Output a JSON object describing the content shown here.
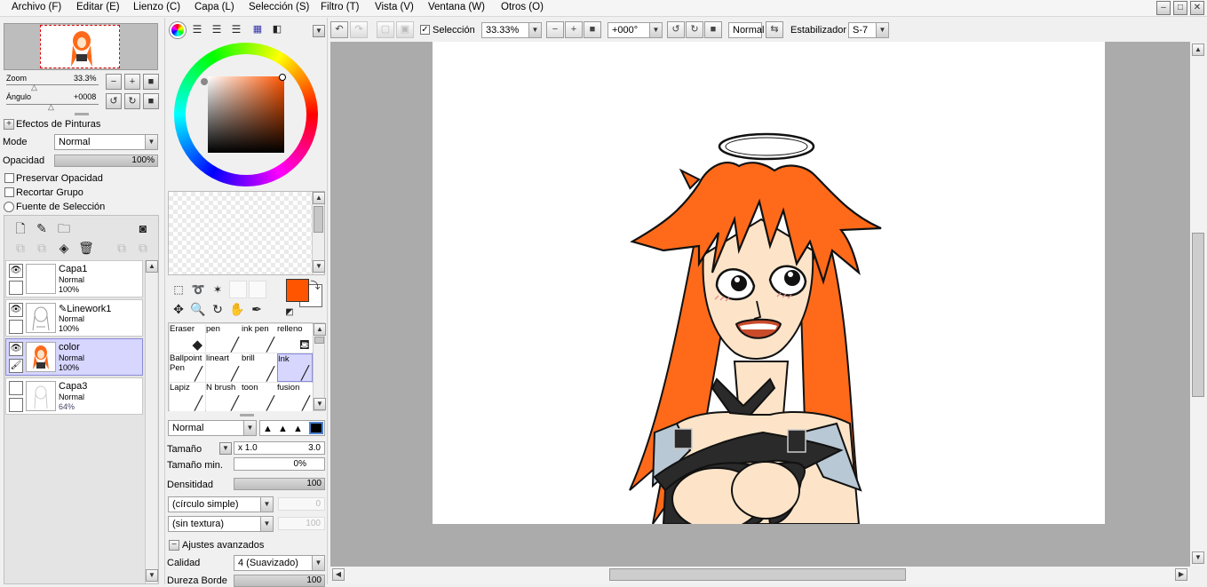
{
  "menu": {
    "items": [
      "Archivo (F)",
      "Editar (E)",
      "Lienzo (C)",
      "Capa (L)",
      "Selección (S)",
      "Filtro (T)",
      "Vista (V)",
      "Ventana (W)",
      "Otros (O)"
    ],
    "window_buttons": [
      "–",
      "□",
      "✕"
    ]
  },
  "toolbar": {
    "selection_label": "Selección",
    "selection_checked": true,
    "zoom_value": "33.33%",
    "angle_value": "+000°",
    "blend_mode": "Normal",
    "stabilizer_label": "Estabilizador",
    "stabilizer_value": "S-7"
  },
  "navigator": {
    "zoom_label": "Zoom",
    "zoom_value": "33.3%",
    "angle_label": "Ángulo",
    "angle_value": "+0008"
  },
  "layer_props": {
    "effects_title": "Efectos de Pinturas",
    "mode_label": "Mode",
    "mode_value": "Normal",
    "opacity_label": "Opacidad",
    "opacity_value": "100%",
    "preserve_opacity": "Preservar Opacidad",
    "clip_group": "Recortar Grupo",
    "selection_source": "Fuente de Selección"
  },
  "layers": [
    {
      "name": "Capa1",
      "mode": "Normal",
      "opacity": "100%",
      "selected": false,
      "icon": ""
    },
    {
      "name": "Linework1",
      "mode": "Normal",
      "opacity": "100%",
      "selected": false,
      "icon": "pen-icon"
    },
    {
      "name": "color",
      "mode": "Normal",
      "opacity": "100%",
      "selected": true,
      "icon": ""
    },
    {
      "name": "Capa3",
      "mode": "Normal",
      "opacity": "64%",
      "selected": false,
      "icon": ""
    }
  ],
  "colors": {
    "foreground": "#ff5500",
    "background": "#ffffff",
    "hair": "#ff6a1a",
    "skin": "#fde4c8",
    "accent_layer": "#d6d6ff"
  },
  "brushes": [
    {
      "name": "Eraser",
      "icon": "eraser-icon"
    },
    {
      "name": "pen",
      "icon": "pen-icon"
    },
    {
      "name": "ink pen",
      "icon": "pen-icon"
    },
    {
      "name": "relleno",
      "icon": "bucket-icon"
    },
    {
      "name": "Ballpoint Pen",
      "icon": "pen-icon"
    },
    {
      "name": "lineart",
      "icon": "pen-icon"
    },
    {
      "name": "brill",
      "icon": "pen-icon"
    },
    {
      "name": "Ink",
      "icon": "pen-icon",
      "selected": true
    },
    {
      "name": "Lapiz",
      "icon": "pencil-icon"
    },
    {
      "name": "N brush",
      "icon": "brush-icon"
    },
    {
      "name": "toon",
      "icon": "brush-icon"
    },
    {
      "name": "fusion",
      "icon": "brush-icon"
    }
  ],
  "brush_settings": {
    "blend_mode": "Normal",
    "size_label": "Tamaño",
    "size_multiplier": "x 1.0",
    "size_value": "3.0",
    "size_value_fraction": 0.0,
    "min_size_label": "Tamaño min.",
    "min_size_value": "0%",
    "density_label": "Densitidad",
    "density_value": "100",
    "shape": "(círculo simple)",
    "shape_amount": "0",
    "texture": "(sin textura)",
    "texture_amount": "100",
    "advanced_label": "Ajustes avanzados",
    "quality_label": "Calidad",
    "quality_value": "4 (Suavizado)",
    "hardness_label": "Dureza Borde",
    "hardness_value": "100"
  }
}
